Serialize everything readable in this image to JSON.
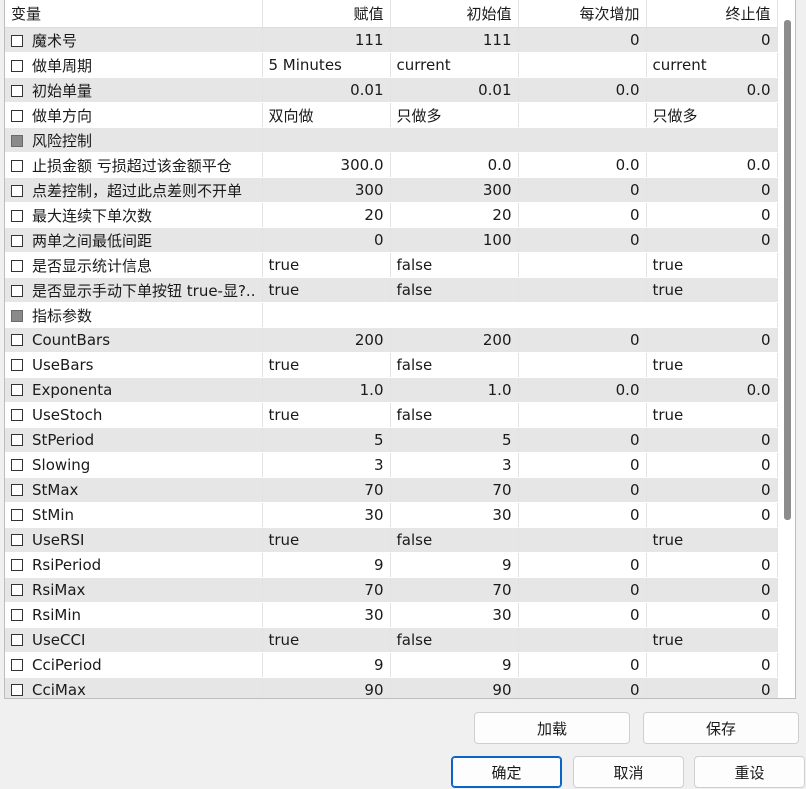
{
  "headers": [
    "变量",
    "赋值",
    "初始值",
    "每次增加",
    "终止值"
  ],
  "rows": [
    {
      "name": "魔术号",
      "group": false,
      "v": "111",
      "init": "111",
      "step": "0",
      "stop": "0",
      "align": "num"
    },
    {
      "name": "做单周期",
      "group": false,
      "v": "5 Minutes",
      "init": "current",
      "step": "",
      "stop": "current",
      "align": "txt"
    },
    {
      "name": "初始单量",
      "group": false,
      "v": "0.01",
      "init": "0.01",
      "step": "0.0",
      "stop": "0.0",
      "align": "num"
    },
    {
      "name": "做单方向",
      "group": false,
      "v": "双向做",
      "init": "只做多",
      "step": "",
      "stop": "只做多",
      "align": "txt"
    },
    {
      "name": "风险控制",
      "group": true,
      "v": "",
      "init": "",
      "step": "",
      "stop": "",
      "align": "txt"
    },
    {
      "name": "止损金额 亏损超过该金额平仓",
      "group": false,
      "v": "300.0",
      "init": "0.0",
      "step": "0.0",
      "stop": "0.0",
      "align": "num"
    },
    {
      "name": "点差控制，超过此点差则不开单",
      "group": false,
      "v": "300",
      "init": "300",
      "step": "0",
      "stop": "0",
      "align": "num"
    },
    {
      "name": "最大连续下单次数",
      "group": false,
      "v": "20",
      "init": "20",
      "step": "0",
      "stop": "0",
      "align": "num"
    },
    {
      "name": "两单之间最低间距",
      "group": false,
      "v": "0",
      "init": "100",
      "step": "0",
      "stop": "0",
      "align": "num"
    },
    {
      "name": "是否显示统计信息",
      "group": false,
      "v": "true",
      "init": "false",
      "step": "",
      "stop": "true",
      "align": "txt"
    },
    {
      "name": "是否显示手动下单按钮 true-显?..",
      "group": false,
      "v": "true",
      "init": "false",
      "step": "",
      "stop": "true",
      "align": "txt"
    },
    {
      "name": "指标参数",
      "group": true,
      "v": "",
      "init": "",
      "step": "",
      "stop": "",
      "align": "txt"
    },
    {
      "name": "CountBars",
      "group": false,
      "v": "200",
      "init": "200",
      "step": "0",
      "stop": "0",
      "align": "num"
    },
    {
      "name": "UseBars",
      "group": false,
      "v": "true",
      "init": "false",
      "step": "",
      "stop": "true",
      "align": "txt"
    },
    {
      "name": "Exponenta",
      "group": false,
      "v": "1.0",
      "init": "1.0",
      "step": "0.0",
      "stop": "0.0",
      "align": "num"
    },
    {
      "name": "UseStoch",
      "group": false,
      "v": "true",
      "init": "false",
      "step": "",
      "stop": "true",
      "align": "txt"
    },
    {
      "name": "StPeriod",
      "group": false,
      "v": "5",
      "init": "5",
      "step": "0",
      "stop": "0",
      "align": "num"
    },
    {
      "name": "Slowing",
      "group": false,
      "v": "3",
      "init": "3",
      "step": "0",
      "stop": "0",
      "align": "num"
    },
    {
      "name": "StMax",
      "group": false,
      "v": "70",
      "init": "70",
      "step": "0",
      "stop": "0",
      "align": "num"
    },
    {
      "name": "StMin",
      "group": false,
      "v": "30",
      "init": "30",
      "step": "0",
      "stop": "0",
      "align": "num"
    },
    {
      "name": "UseRSI",
      "group": false,
      "v": "true",
      "init": "false",
      "step": "",
      "stop": "true",
      "align": "txt"
    },
    {
      "name": "RsiPeriod",
      "group": false,
      "v": "9",
      "init": "9",
      "step": "0",
      "stop": "0",
      "align": "num"
    },
    {
      "name": "RsiMax",
      "group": false,
      "v": "70",
      "init": "70",
      "step": "0",
      "stop": "0",
      "align": "num"
    },
    {
      "name": "RsiMin",
      "group": false,
      "v": "30",
      "init": "30",
      "step": "0",
      "stop": "0",
      "align": "num"
    },
    {
      "name": "UseCCI",
      "group": false,
      "v": "true",
      "init": "false",
      "step": "",
      "stop": "true",
      "align": "txt"
    },
    {
      "name": "CciPeriod",
      "group": false,
      "v": "9",
      "init": "9",
      "step": "0",
      "stop": "0",
      "align": "num"
    },
    {
      "name": "CciMax",
      "group": false,
      "v": "90",
      "init": "90",
      "step": "0",
      "stop": "0",
      "align": "num"
    }
  ],
  "buttons": {
    "load": "加载",
    "save": "保存",
    "ok": "确定",
    "cancel": "取消",
    "reset": "重设"
  },
  "colors": {
    "accent": "#0a64c8",
    "row_alt": "#e6e6e6"
  }
}
